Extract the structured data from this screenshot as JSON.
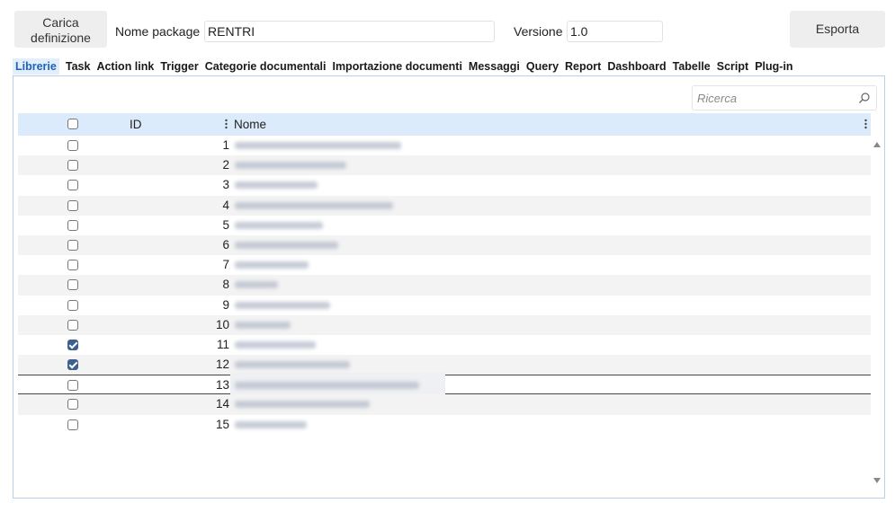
{
  "toolbar": {
    "load_label": "Carica definizione",
    "package_label": "Nome package",
    "package_value": "RENTRI",
    "version_label": "Versione",
    "version_value": "1.0",
    "export_label": "Esporta"
  },
  "tabs": [
    "Librerie",
    "Task",
    "Action link",
    "Trigger",
    "Categorie documentali",
    "Importazione documenti",
    "Messaggi",
    "Query",
    "Report",
    "Dashboard",
    "Tabelle",
    "Script",
    "Plug-in"
  ],
  "active_tab": "Librerie",
  "search": {
    "placeholder": "Ricerca"
  },
  "table": {
    "columns": [
      "ID",
      "Nome"
    ],
    "rows": [
      {
        "id": "1",
        "checked": false
      },
      {
        "id": "2",
        "checked": false
      },
      {
        "id": "3",
        "checked": false
      },
      {
        "id": "4",
        "checked": false
      },
      {
        "id": "5",
        "checked": false
      },
      {
        "id": "6",
        "checked": false
      },
      {
        "id": "7",
        "checked": false
      },
      {
        "id": "8",
        "checked": false
      },
      {
        "id": "9",
        "checked": false
      },
      {
        "id": "10",
        "checked": false
      },
      {
        "id": "11",
        "checked": true
      },
      {
        "id": "12",
        "checked": true
      },
      {
        "id": "13",
        "checked": false
      },
      {
        "id": "14",
        "checked": false
      },
      {
        "id": "15",
        "checked": false
      }
    ],
    "selected_row_id": "13"
  },
  "colors": {
    "accent": "#1e63b5",
    "header_bg": "#dcebfb",
    "panel_border": "#b6d0ee",
    "checked": "#3f5f8f"
  }
}
